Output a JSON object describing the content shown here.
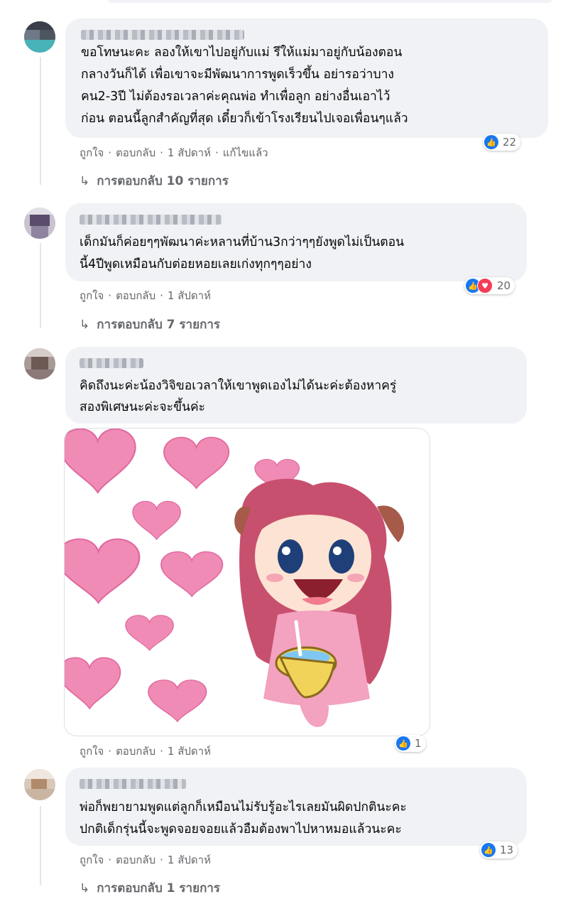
{
  "comments": [
    {
      "text_lines": [
        "ขอโทษนะคะ ลองให้เขาไปอยู่กับแม่ รึให้แม่มาอยู่กับน้องตอน",
        "กลางวันก็ได้ เพื่อเขาจะมีพัฒนาการพูดเร็วขึ้น อย่ารอว่าบาง",
        "คน2-3ปี ไม่ต้องรอเวลาค่ะคุณพ่อ ทำเพื่อลูก อย่างอื่นเอาไว้",
        "ก่อน ตอนนี้ลูกสำคัญที่สุด เดี๋ยวก็เข้าโรงเรียนไปเจอเพื่อนๆแล้ว"
      ],
      "like": "ถูกใจ",
      "reply": "ตอบกลับ",
      "time": "1 สัปดาห์",
      "edited": "แก้ไขแล้ว",
      "reaction_count": "22",
      "replies_label": "การตอบกลับ 10 รายการ"
    },
    {
      "text_lines": [
        "เด็กมันก็ค่อยๆๆพัฒนาค่ะหลานที่บ้าน3กว่าๆๆยังพูดไม่เป็นตอน",
        "นี้4ปีพูดเหมือนกับต่อยหอยเลยเก่งทุกๆๆอย่าง"
      ],
      "like": "ถูกใจ",
      "reply": "ตอบกลับ",
      "time": "1 สัปดาห์",
      "reaction_count": "20",
      "replies_label": "การตอบกลับ 7 รายการ"
    },
    {
      "text_lines": [
        "คิดถึงนะค่ะน้องวิจิขอเวลาให้เขาพูดเองไม่ได้นะค่ะต้องหาครู่",
        "สองพิเศษนะค่ะจะขึ้นค่ะ"
      ],
      "like": "ถูกใจ",
      "reply": "ตอบกลับ",
      "time": "1 สัปดาห์",
      "reaction_count": "1"
    },
    {
      "text_lines": [
        "พ่อก็พยายามพูดแต่ลูกก็เหมือนไม่รับรู้อะไรเลยมันผิดปกตินะคะ",
        "ปกติเด็กรุ่นนี้จะพูดจอยจอยแล้วอืมต้องพาไปหาหมอแล้วนะคะ"
      ],
      "like": "ถูกใจ",
      "reply": "ตอบกลับ",
      "time": "1 สัปดาห์",
      "reaction_count": "13",
      "replies_label": "การตอบกลับ 1 รายการ"
    }
  ],
  "icons": {
    "like": "thumbs-up-icon",
    "love": "heart-icon",
    "reply_arrow": "reply-arrow-icon"
  },
  "colors": {
    "bubble": "#f0f2f5",
    "like_blue": "#1877f2",
    "love_red": "#f33e58",
    "meta_gray": "#65676b"
  }
}
